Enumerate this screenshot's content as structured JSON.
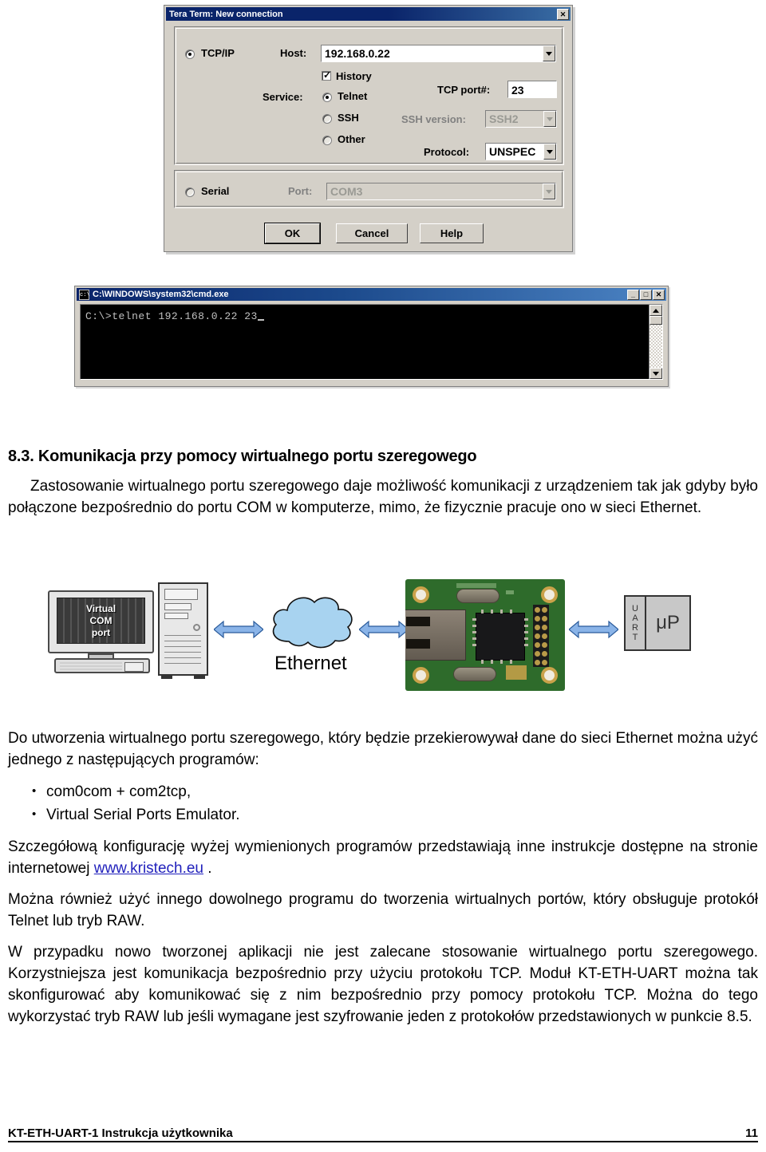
{
  "teraterm": {
    "title": "Tera Term: New connection",
    "close_label": "✕",
    "tcpip_label": "TCP/IP",
    "host_label": "Host:",
    "host_value": "192.168.0.22",
    "history_label": "History",
    "service_label": "Service:",
    "service_options": [
      "Telnet",
      "SSH",
      "Other"
    ],
    "telnet_label": "Telnet",
    "ssh_label": "SSH",
    "other_label": "Other",
    "tcp_port_label": "TCP port#:",
    "tcp_port_value": "23",
    "ssh_version_label": "SSH version:",
    "ssh_version_value": "SSH2",
    "protocol_label": "Protocol:",
    "protocol_value": "UNSPEC",
    "serial_label": "Serial",
    "port_label": "Port:",
    "port_value": "COM3",
    "ok_label": "OK",
    "cancel_label": "Cancel",
    "help_label": "Help"
  },
  "cmd": {
    "title": "C:\\WINDOWS\\system32\\cmd.exe",
    "icon_text": "c:\\",
    "minimize_label": "_",
    "maximize_label": "□",
    "close_label": "✕",
    "console_text": "C:\\>telnet 192.168.0.22 23"
  },
  "document": {
    "heading": "8.3. Komunikacja przy pomocy wirtualnego portu szeregowego",
    "intro": "Zastosowanie wirtualnego portu szeregowego daje możliwość komunikacji z urządzeniem tak jak gdyby było połączone bezpośrednio do portu COM w komputerze, mimo, że fizycznie pracuje ono w sieci Ethernet.",
    "para_programs": "Do utworzenia wirtualnego portu szeregowego, który będzie przekierowywał dane do sieci Ethernet można użyć jednego z następujących programów:",
    "programs": [
      "com0com + com2tcp,",
      "Virtual Serial Ports Emulator."
    ],
    "para_config_part1": "Szczegółową konfigurację wyżej wymienionych programów przedstawiają inne instrukcje dostępne na stronie internetowej ",
    "link_text": "www.kristech.eu",
    "para_config_part2": " .",
    "para_other": "Można również użyć innego dowolnego programu do tworzenia wirtualnych portów, który obsługuje protokół Telnet lub tryb RAW.",
    "para_recommend": "W przypadku nowo tworzonej aplikacji nie jest zalecane stosowanie wirtualnego portu szeregowego. Korzystniejsza jest komunikacja bezpośrednio przy użyciu protokołu TCP. Moduł KT-ETH-UART można tak skonfigurować aby komunikować się z nim bezpośrednio przy pomocy protokołu TCP. Można do tego wykorzystać tryb RAW lub jeśli wymagane jest szyfrowanie jeden z protokołów przedstawionych w punkcie 8.5."
  },
  "figure": {
    "monitor_line1": "Virtual",
    "monitor_line2": "COM",
    "monitor_line3": "port",
    "ethernet_label": "Ethernet",
    "uart_letters": [
      "U",
      "A",
      "R",
      "T"
    ],
    "mcu_label": "μP",
    "arrow_color": "#8ab4e8"
  },
  "footer": {
    "left": "KT-ETH-UART-1  Instrukcja użytkownika",
    "page": "11"
  }
}
